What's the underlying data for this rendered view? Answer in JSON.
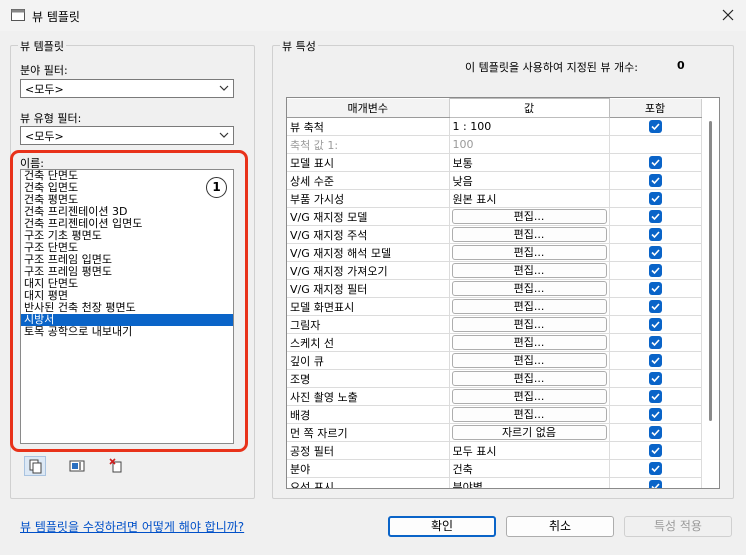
{
  "window": {
    "title": "뷰 템플릿",
    "close_icon": "close-icon",
    "app_icon": "window-icon"
  },
  "left_panel": {
    "group_label": "뷰 템플릿",
    "discipline_filter": {
      "label": "분야 필터:",
      "value": "<모두>"
    },
    "view_type_filter": {
      "label": "뷰 유형 필터:",
      "value": "<모두>"
    },
    "names": {
      "label": "이름:",
      "items": [
        "건축 단면도",
        "건축 입면도",
        "건축 평면도",
        "건축 프리젠테이션 3D",
        "건축 프리젠테이션 입면도",
        "구조 기초 평면도",
        "구조 단면도",
        "구조 프레임 입면도",
        "구조 프레임 평면도",
        "대지 단면도",
        "대지 평면",
        "반사된 건축 천장 평면도",
        "시방서",
        "토목 공학으로 내보내기"
      ],
      "selected_index": 12
    },
    "callout_number": "1",
    "tools": [
      {
        "name": "duplicate-icon"
      },
      {
        "name": "rename-icon"
      },
      {
        "name": "delete-icon"
      }
    ]
  },
  "right_panel": {
    "group_label": "뷰 특성",
    "count_label": "이 템플릿을 사용하여 지정된 뷰 개수:",
    "count_value": "0",
    "columns": {
      "param": "매개변수",
      "value": "값",
      "include": "포함"
    },
    "rows": [
      {
        "param": "뷰 축척",
        "value": "1 : 100",
        "type": "text",
        "include": true
      },
      {
        "param": "축척 값    1:",
        "value": "100",
        "type": "text",
        "include": null,
        "disabled": true
      },
      {
        "param": "모델 표시",
        "value": "보통",
        "type": "text",
        "include": true
      },
      {
        "param": "상세 수준",
        "value": "낮음",
        "type": "text",
        "include": true
      },
      {
        "param": "부품 가시성",
        "value": "원본 표시",
        "type": "text",
        "include": true
      },
      {
        "param": "V/G 재지정 모델",
        "value": "편집...",
        "type": "button",
        "include": true
      },
      {
        "param": "V/G 재지정 주석",
        "value": "편집...",
        "type": "button",
        "include": true
      },
      {
        "param": "V/G 재지정 해석 모델",
        "value": "편집...",
        "type": "button",
        "include": true
      },
      {
        "param": "V/G 재지정 가져오기",
        "value": "편집...",
        "type": "button",
        "include": true
      },
      {
        "param": "V/G 재지정 필터",
        "value": "편집...",
        "type": "button",
        "include": true
      },
      {
        "param": "모델 화면표시",
        "value": "편집...",
        "type": "button",
        "include": true
      },
      {
        "param": "그림자",
        "value": "편집...",
        "type": "button",
        "include": true
      },
      {
        "param": "스케치 선",
        "value": "편집...",
        "type": "button",
        "include": true
      },
      {
        "param": "깊이 큐",
        "value": "편집...",
        "type": "button",
        "include": true
      },
      {
        "param": "조명",
        "value": "편집...",
        "type": "button",
        "include": true
      },
      {
        "param": "사진 촬영 노출",
        "value": "편집...",
        "type": "button",
        "include": true
      },
      {
        "param": "배경",
        "value": "편집...",
        "type": "button",
        "include": true
      },
      {
        "param": "먼 쪽 자르기",
        "value": "자르기 없음",
        "type": "button",
        "include": true
      },
      {
        "param": "공정 필터",
        "value": "모두 표시",
        "type": "text",
        "include": true
      },
      {
        "param": "분야",
        "value": "건축",
        "type": "text",
        "include": true
      },
      {
        "param": "요선 표시",
        "value": "분야별",
        "type": "text",
        "include": true
      }
    ]
  },
  "footer": {
    "help_link": "뷰 템플릿을 수정하려면 어떻게 해야 합니까?",
    "ok": "확인",
    "cancel": "취소",
    "apply": "특성 적용"
  },
  "colors": {
    "accent": "#0a64c8",
    "highlight": "#e8321a",
    "link": "#0050c8"
  }
}
